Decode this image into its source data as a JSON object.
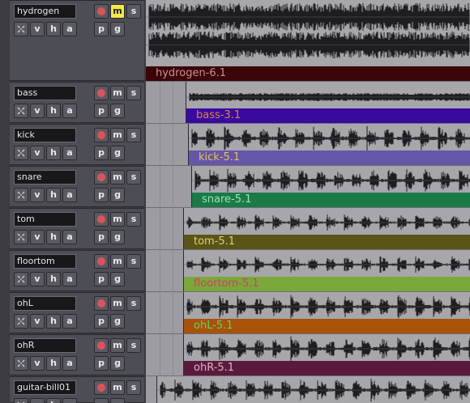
{
  "button_labels": {
    "mute": "m",
    "solo": "s",
    "view": "v",
    "hide": "h",
    "auto": "a",
    "playlist": "p",
    "group": "g"
  },
  "colors": {
    "mute_active": "#f2e84a",
    "record_button": "#d9545a",
    "canvas_bg": "#9c9ca2",
    "header_bg": "#4d4d55"
  },
  "tracks": [
    {
      "name": "hydrogen",
      "muted": true,
      "region": {
        "name": "hydrogen-6.1",
        "bar_color": "#3a0608",
        "text_color": "#d1898f"
      }
    },
    {
      "name": "bass",
      "muted": false,
      "region": {
        "name": "bass-3.1",
        "bar_color": "#3a0aa0",
        "text_color": "#d98a3a"
      }
    },
    {
      "name": "kick",
      "muted": false,
      "region": {
        "name": "kick-5.1",
        "bar_color": "#6656a8",
        "text_color": "#e0c35a"
      }
    },
    {
      "name": "snare",
      "muted": false,
      "region": {
        "name": "snare-5.1",
        "bar_color": "#1a7a48",
        "text_color": "#9fe0b8"
      }
    },
    {
      "name": "tom",
      "muted": false,
      "region": {
        "name": "tom-5.1",
        "bar_color": "#5a5418",
        "text_color": "#e0d06a"
      }
    },
    {
      "name": "floortom",
      "muted": false,
      "region": {
        "name": "floortom-5.1",
        "bar_color": "#7aa83a",
        "text_color": "#d83a6a"
      }
    },
    {
      "name": "ohL",
      "muted": false,
      "region": {
        "name": "ohL-5.1",
        "bar_color": "#a8520a",
        "text_color": "#5ad86a"
      }
    },
    {
      "name": "ohR",
      "muted": false,
      "region": {
        "name": "ohR-5.1",
        "bar_color": "#5a1a3e",
        "text_color": "#e6b0c0"
      }
    },
    {
      "name": "guitar-bill01",
      "muted": false,
      "region": {
        "name": "",
        "bar_color": "#000000",
        "text_color": "#000000"
      }
    }
  ]
}
